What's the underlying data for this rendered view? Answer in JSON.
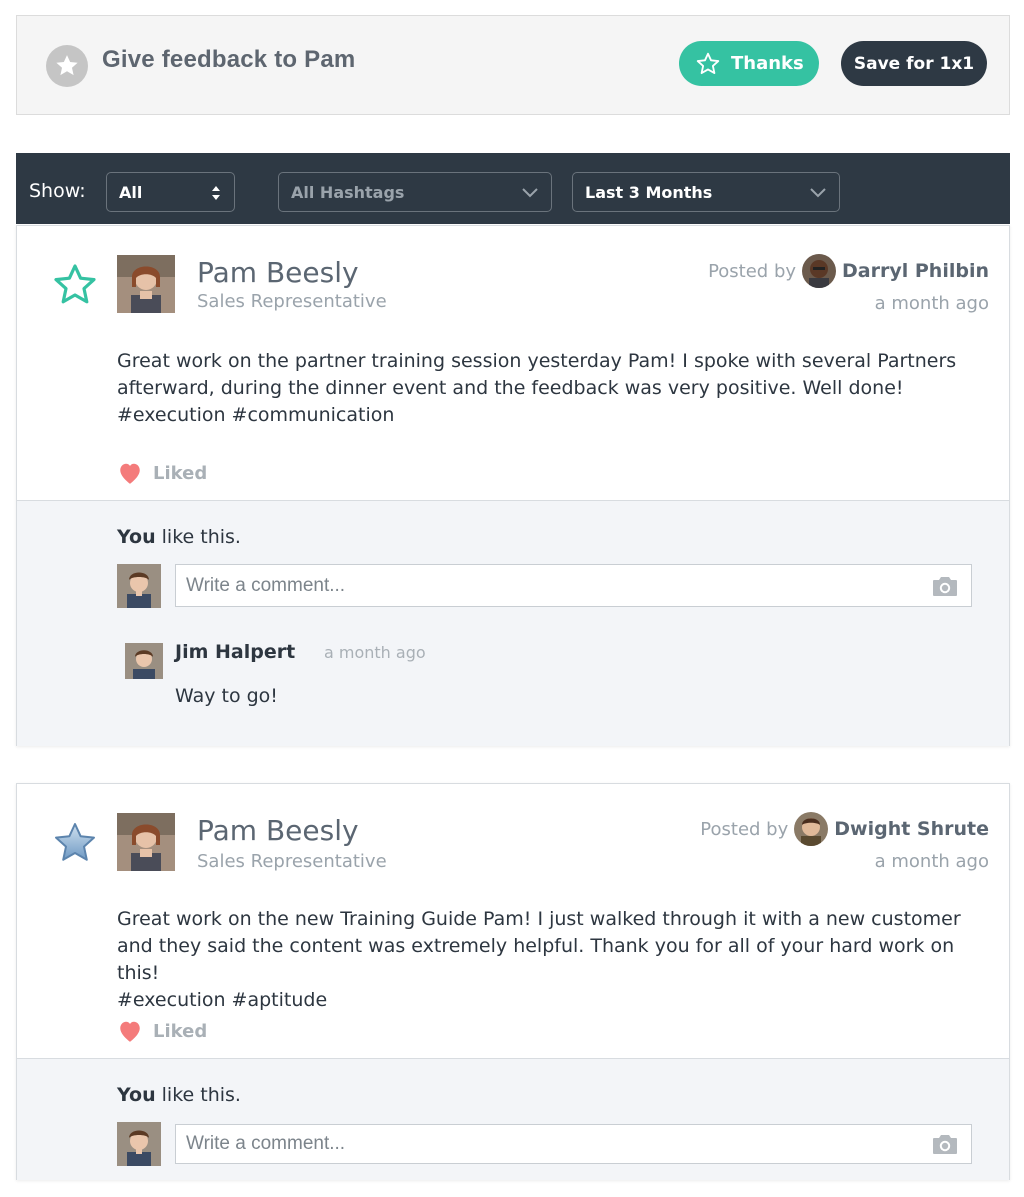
{
  "header": {
    "title": "Give feedback to Pam",
    "thanks_label": "Thanks",
    "save_label": "Save for 1x1"
  },
  "filters": {
    "show_label": "Show:",
    "show_value": "All",
    "hashtags_value": "All Hashtags",
    "period_value": "Last 3 Months"
  },
  "posts": [
    {
      "author_name": "Pam Beesly",
      "author_role": "Sales Representative",
      "posted_by_label": "Posted by",
      "poster_name": "Darryl Philbin",
      "time": "a month ago",
      "body": "Great work on the partner training session yesterday Pam!  I spoke with several Partners afterward, during the dinner event and the feedback was very positive. Well done!",
      "hashtags": "#execution #communication",
      "like_label": "Liked",
      "you_like_bold": "You",
      "you_like_rest": " like this.",
      "comment_placeholder": "Write a comment...",
      "comment": {
        "name": "Jim Halpert",
        "time": "a month ago",
        "text": "Way to go!"
      }
    },
    {
      "author_name": "Pam Beesly",
      "author_role": "Sales Representative",
      "posted_by_label": "Posted by",
      "poster_name": "Dwight Shrute",
      "time": "a month ago",
      "body": "Great work on the new Training Guide Pam!  I just walked through it with a new customer and they said the content was extremely helpful. Thank you for all of your hard work on this!",
      "hashtags": "#execution #aptitude",
      "like_label": "Liked",
      "you_like_bold": "You",
      "you_like_rest": " like this.",
      "comment_placeholder": "Write a comment..."
    }
  ],
  "colors": {
    "accent_green": "#35c2a2",
    "dark_navy": "#2e3944",
    "heart": "#f47b7b",
    "muted_text": "#9aa3ab"
  }
}
